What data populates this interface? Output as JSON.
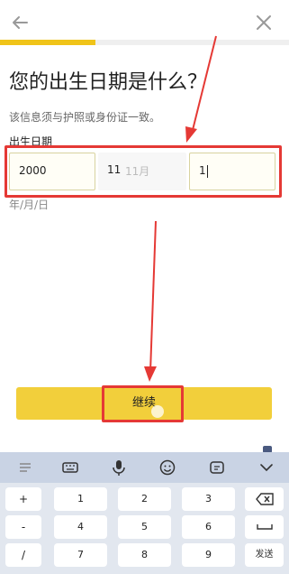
{
  "header": {
    "back_icon": "back-arrow-icon",
    "close_icon": "close-icon",
    "progress_fraction": 0.33,
    "accent_color": "#F0C419"
  },
  "page": {
    "title": "您的出生日期是什么？",
    "subtitle": "该信息须与护照或身份证一致。",
    "field_label": "出生日期"
  },
  "dob": {
    "year_value": "2000",
    "month_value": "11",
    "month_placeholder": "11月",
    "day_value": "1"
  },
  "hint": "年/月/日",
  "continue_label": "继续",
  "annotation_color": "#E53935",
  "keyboard": {
    "toolbar": [
      "keyboard-icon",
      "mic-icon",
      "emoji-icon",
      "clipboard-icon",
      "chevron-down-icon"
    ],
    "side_keys": [
      "+",
      "-",
      "/"
    ],
    "rows": [
      [
        "1",
        "2",
        "3"
      ],
      [
        "4",
        "5",
        "6"
      ],
      [
        "7",
        "8",
        "9"
      ]
    ],
    "send_label": "发送"
  }
}
